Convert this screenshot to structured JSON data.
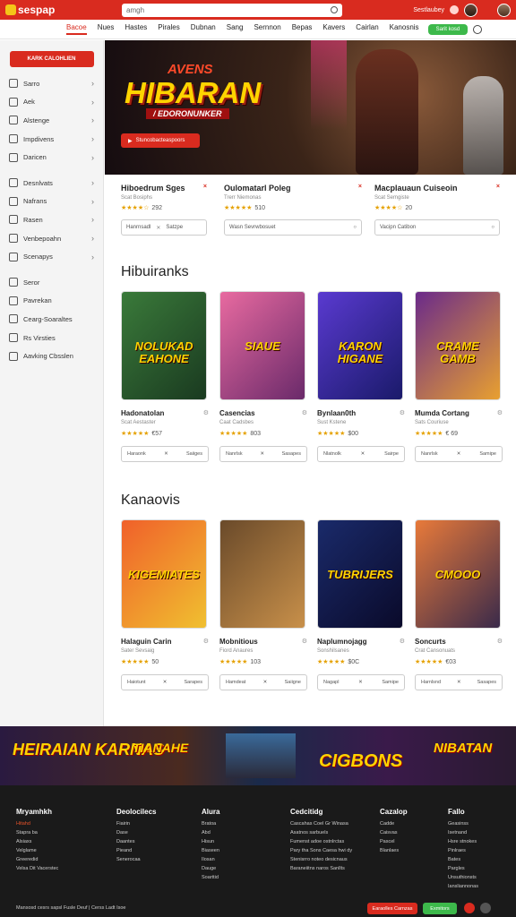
{
  "topbar": {
    "logo": "sespap",
    "search_placeholder": "amgh",
    "link": "Sestlaubey",
    "bg_color": "#d92b1f"
  },
  "nav": {
    "items": [
      "Bacoe",
      "Nues",
      "Hastes",
      "Pirales",
      "Dubnan",
      "Sang",
      "Sernnon",
      "Bepas",
      "Kavers",
      "Cairlan",
      "Kanosnis"
    ],
    "cta": "Sarit kosd"
  },
  "sidebar": {
    "cta": "KARK CALOHLIEN",
    "items": [
      {
        "label": "Sarro",
        "icon": "list-icon",
        "chev": "›"
      },
      {
        "label": "Aek",
        "icon": "box-icon",
        "chev": "›"
      },
      {
        "label": "Alstenge",
        "icon": "chart-icon",
        "chev": "›"
      },
      {
        "label": "Impdivens",
        "icon": "pointer-icon",
        "chev": "›"
      },
      {
        "label": "Daricen",
        "icon": "calendar-icon",
        "chev": "›"
      },
      {
        "label": "Desnlvats",
        "icon": "pen-icon",
        "chev": "›"
      },
      {
        "label": "Nafrans",
        "icon": "gamepad-icon",
        "chev": "›"
      },
      {
        "label": "Rasen",
        "icon": "chat-icon",
        "chev": "›"
      },
      {
        "label": "Venbepoahn",
        "icon": "folder-icon",
        "chev": "›"
      },
      {
        "label": "Scenapys",
        "icon": "grid-icon",
        "chev": "›"
      },
      {
        "label": "Seror",
        "icon": "search-icon",
        "chev": ""
      },
      {
        "label": "Pavrekan",
        "icon": "edit-icon",
        "chev": ""
      },
      {
        "label": "Cearg-Soaraltes",
        "icon": "people-icon",
        "chev": ""
      },
      {
        "label": "Rs Virsties",
        "icon": "doc-icon",
        "chev": ""
      },
      {
        "label": "Aavking Cbsslen",
        "icon": "note-icon",
        "chev": ""
      }
    ]
  },
  "hero": {
    "kicker": "AVENS",
    "title": "HIBARAN",
    "subtitle": "/ EDORONUNKER",
    "button": "Stuncobacteaspoors"
  },
  "featured": [
    {
      "title": "Hiboedrum Sges",
      "sub": "Scat Bosiphs",
      "rating": "★★★★☆",
      "score": "292",
      "left": "Hanrnsadl",
      "right": "Satzpe"
    },
    {
      "title": "Oulomatarl Poleg",
      "sub": "Trerr Niemonas",
      "rating": "★★★★★",
      "score": "510",
      "left": "Wasn Sevrwbosuet",
      "right": ""
    },
    {
      "title": "Macplauaun Cuiseoin",
      "sub": "Scat Semgiste",
      "rating": "★★★★☆",
      "score": "20",
      "left": "Vacipn Catibon",
      "right": ""
    }
  ],
  "sections": [
    {
      "title": "Hibuiranks",
      "cards": [
        {
          "cover": "NOLUKAD EAHONE",
          "title": "Hadonatolan",
          "sub": "Scat Aestaster",
          "rating": "★★★★★",
          "score": "€57",
          "left": "Haraonk",
          "right": "Saiiges"
        },
        {
          "cover": "SIAUE",
          "title": "Casencias",
          "sub": "Caat Cadsbes",
          "rating": "★★★★★",
          "score": "803",
          "left": "Nanrlsk",
          "right": "Sasapes"
        },
        {
          "cover": "KARON HIGANE",
          "title": "Bynlaan0th",
          "sub": "Sust Kstene",
          "rating": "★★★★★",
          "score": "$00",
          "left": "Nlatnolk",
          "right": "Sairpe"
        },
        {
          "cover": "CRAME GAMB",
          "title": "Mumda Cortang",
          "sub": "Sats Couriuse",
          "rating": "★★★★★",
          "score": "€ 69",
          "left": "Nanrlsk",
          "right": "Samipe"
        }
      ]
    },
    {
      "title": "Kanaovis",
      "cards": [
        {
          "cover": "KIGEMIATES",
          "title": "Halaguin Carin",
          "sub": "Sater Sevsaig",
          "rating": "★★★★★",
          "score": "50",
          "left": "Haiotunt",
          "right": "Sarapes"
        },
        {
          "cover": "",
          "title": "Mobnitious",
          "sub": "Fiord Anaures",
          "rating": "★★★★★",
          "score": "103",
          "left": "Hamdeat",
          "right": "Saiigne"
        },
        {
          "cover": "TUBRIJERS",
          "title": "Naplumnojagg",
          "sub": "Sonshilsanes",
          "rating": "★★★★★",
          "score": "$0C",
          "left": "Nagapl",
          "right": "Samipe"
        },
        {
          "cover": "CMOOO",
          "title": "Soncurts",
          "sub": "Crat Cansonuats",
          "rating": "★★★★★",
          "score": "€03",
          "left": "Harnlsnd",
          "right": "Sasapes"
        }
      ]
    }
  ],
  "promo": [
    "HEIRAIAN KARNAS",
    "TIANAHE",
    "CIGBONS",
    "NIBATAN"
  ],
  "footer": {
    "columns": [
      {
        "head": "Mryamhkh",
        "lines": [
          "Hitahd",
          "Stapra ba",
          "Alsiaxs",
          "Velglame",
          "Greeredid",
          "Velsa Dit Vacerstec"
        ]
      },
      {
        "head": "Deolocilecs",
        "lines": [
          "Fiairin",
          "Dase",
          "Daantes",
          "Pieand",
          "Senerocaa"
        ]
      },
      {
        "head": "Alura",
        "lines": [
          "Bratoa",
          "Abd",
          "Hisun",
          "Biaseen",
          "Ilosan",
          "Dauge",
          "Soarttid"
        ]
      },
      {
        "head": "Cedcitidg",
        "lines": [
          "Cascahas Coel Gr Winasa",
          "Asatnos sarbuels",
          "Fumenst adoe ostnlrctas",
          "Pary tha Sons Caesa hwi dy",
          "Stenisrro noteo desicnaus",
          "Baraneiitns naros Sanllts"
        ]
      },
      {
        "head": "Cazalop",
        "lines": [
          "Cadde",
          "Caisvas",
          "Pascel",
          "Blanlaes"
        ]
      },
      {
        "head": "Fallo",
        "lines": [
          "Geasinss",
          "Isetnand",
          "Hsre stnokes",
          "Pinlraes",
          "Bates",
          "Pargles",
          "Unsuthionsts",
          "Iansliannonas"
        ]
      }
    ],
    "bottom": "Mansosd cesrs sapsl Fusle Deuf | Cerss Ladt Isoe",
    "btn_red": "Earaolles Carnzas",
    "btn_green": "Exmitors"
  }
}
